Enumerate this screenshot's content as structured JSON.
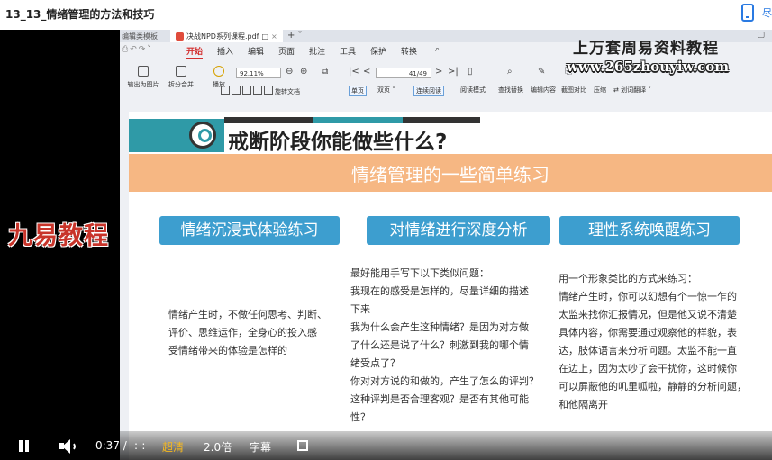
{
  "window": {
    "title": "13_13_情绪管理的方法和技巧",
    "right_edge_char": "尽"
  },
  "app": {
    "tab_left": "编辑类模板",
    "doc_tab": "决战NPD系列课程.pdf",
    "menu": [
      "开始",
      "插入",
      "编辑",
      "页面",
      "批注",
      "工具",
      "保护",
      "转换"
    ],
    "toolbar": {
      "export_img": "输出为图片",
      "split_merge": "拆分合并",
      "play": "播放",
      "zoom_value": "92.11%",
      "rotate": "旋转文档",
      "single_page": "单页",
      "double_page": "双页",
      "continuous": "连续阅读",
      "read_mode": "阅读模式",
      "page_value": "41/49",
      "find_replace": "查找替换",
      "edit_content": "编辑内容",
      "screenshot_compare": "截图对比",
      "compress": "压缩",
      "translate": "划词翻译"
    }
  },
  "watermark": {
    "line1": "上万套周易资料教程",
    "line2": "www.265zhouyiw.com",
    "brand": "九易教程"
  },
  "slide": {
    "title": "戒断阶段你能做些什么?",
    "subtitle": "情绪管理的一些简单练习",
    "columns": [
      {
        "heading": "情绪沉浸式体验练习",
        "lines": [
          "情绪产生时，不做任何思考、判断、",
          "评价、思维运作，全身心的投入感",
          "受情绪带来的体验是怎样的"
        ]
      },
      {
        "heading": "对情绪进行深度分析",
        "lines": [
          "最好能用手写下以下类似问题：",
          "我现在的感受是怎样的，尽量详细的描述",
          "下来",
          "我为什么会产生这种情绪？是因为对方做",
          "了什么还是说了什么？刺激到我的哪个情",
          "绪受点了？",
          "你对对方说的和做的，产生了怎么的评判？",
          "这种评判是否合理客观？是否有其他可能",
          "性？"
        ]
      },
      {
        "heading": "理性系统唤醒练习",
        "lines": [
          "用一个形象类比的方式来练习：",
          "情绪产生时，你可以幻想有个一惊一乍的",
          "太监来找你汇报情况，但是他又说不清楚",
          "具体内容，你需要通过观察他的样貌，表",
          "达，肢体语言来分析问题。太监不能一直",
          "在边上，因为太吵了会干扰你，这时候你",
          "可以屏蔽他的叽里呱啦，静静的分析问题，",
          "和他隔离开"
        ]
      }
    ]
  },
  "player": {
    "time": "0:37 / -:-:-",
    "quality": "超清",
    "speed": "2.0倍",
    "subtitle": "字幕"
  },
  "colors": {
    "accent_red": "#d32f2f",
    "teal": "#2f9aa7",
    "box_blue": "#3d9ecf",
    "band_orange": "#f6b783",
    "quality_gold": "#f5b81e"
  }
}
